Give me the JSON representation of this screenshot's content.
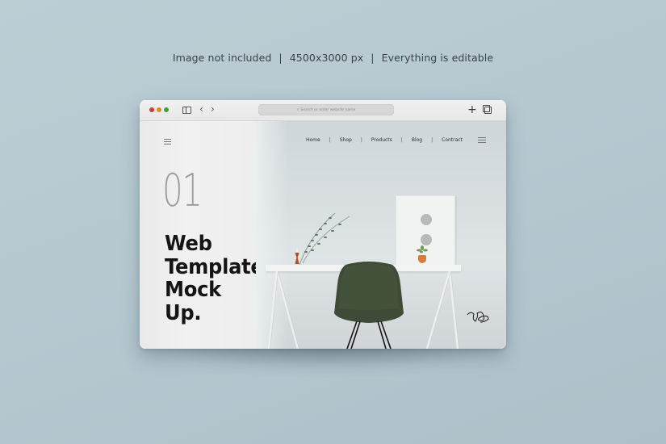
{
  "caption": {
    "items": [
      "Image not included",
      "4500x3000 px",
      "Everything is editable"
    ],
    "separator": "|"
  },
  "browser": {
    "traffic_lights": {
      "close": "#d63a2f",
      "minimize": "#e38a1e",
      "maximize": "#3aa43a"
    },
    "back_label": "‹",
    "forward_label": "›",
    "address_placeholder": "Search or enter website name",
    "search_glyph": "⌕",
    "new_tab_label": "+"
  },
  "page": {
    "number": "01",
    "headline": [
      "Web",
      "Template",
      "Mock",
      "Up."
    ],
    "nav": {
      "items": [
        "Home",
        "Shop",
        "Products",
        "Blog",
        "Contract"
      ],
      "separator": "|"
    }
  },
  "colors": {
    "background": "#b8c9d1",
    "chair": "#3f4b36",
    "pot": "#d77c3a",
    "vase": "#b14a22"
  }
}
